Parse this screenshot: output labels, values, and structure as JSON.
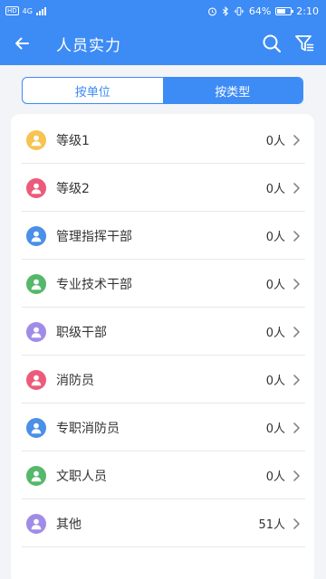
{
  "status_bar": {
    "left_badge": "HD",
    "network": "4G",
    "battery_text": "64%",
    "battery_level": 0.64,
    "time": "2:10"
  },
  "app_bar": {
    "title": "人员实力",
    "back_icon": "arrow-left-icon",
    "search_icon": "search-icon",
    "filter_icon": "filter-icon"
  },
  "tabs": [
    {
      "label": "按单位",
      "active": false
    },
    {
      "label": "按类型",
      "active": true
    }
  ],
  "items": [
    {
      "label": "等级1",
      "count": "0人",
      "color": "#f7c351"
    },
    {
      "label": "等级2",
      "count": "0人",
      "color": "#ec5b79"
    },
    {
      "label": "管理指挥干部",
      "count": "0人",
      "color": "#4a8fe8"
    },
    {
      "label": "专业技术干部",
      "count": "0人",
      "color": "#55b86a"
    },
    {
      "label": "职级干部",
      "count": "0人",
      "color": "#a08ce8"
    },
    {
      "label": "消防员",
      "count": "0人",
      "color": "#ec5b79"
    },
    {
      "label": "专职消防员",
      "count": "0人",
      "color": "#4a8fe8"
    },
    {
      "label": "文职人员",
      "count": "0人",
      "color": "#55b86a"
    },
    {
      "label": "其他",
      "count": "51人",
      "color": "#a08ce8"
    }
  ],
  "colors": {
    "primary": "#3d8bf5",
    "background": "#f2f4f7"
  }
}
